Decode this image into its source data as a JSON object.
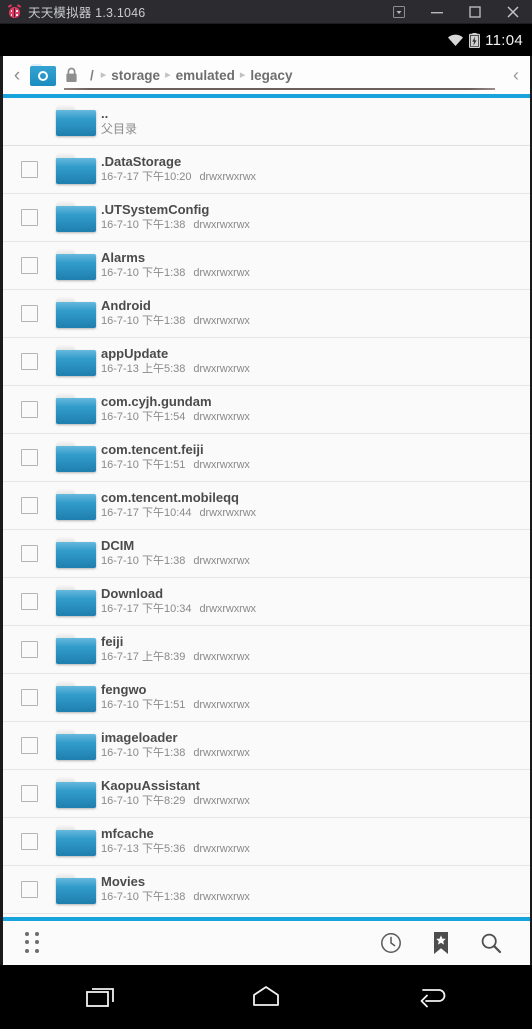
{
  "window": {
    "title": "天天模拟器 1.3.1046",
    "logo_icon": "ladybug-logo-icon",
    "controls": [
      {
        "name": "dropdown-box-button",
        "icon": "box-dropdown-icon",
        "label": ""
      },
      {
        "name": "minimize-button",
        "icon": "minimize-icon",
        "label": ""
      },
      {
        "name": "maximize-button",
        "icon": "maximize-icon",
        "label": ""
      },
      {
        "name": "close-button",
        "icon": "close-icon",
        "label": ""
      }
    ]
  },
  "statusbar": {
    "wifi_icon": "wifi-icon",
    "battery_icon": "battery-charging-icon",
    "clock": "11:04"
  },
  "addressbar": {
    "back_chevron": "‹",
    "folder_icon": "folder-root-icon",
    "lock_icon": "lock-icon",
    "root_label": "/",
    "separator": "▸",
    "crumbs": [
      "storage",
      "emulated",
      "legacy"
    ],
    "collapse_chevron": "‹"
  },
  "colors": {
    "accent": "#17a3dc",
    "folder_blue": "#2e97c6",
    "titlebar": "#2b2b30",
    "logo": "#e23b63"
  },
  "files": [
    {
      "name": "..",
      "sub": "父目录",
      "date": "",
      "perm": "",
      "checkbox": false,
      "parent": true
    },
    {
      "name": ".DataStorage",
      "sub": "",
      "date": "16-7-17 下午10:20",
      "perm": "drwxrwxrwx",
      "checkbox": true,
      "parent": false
    },
    {
      "name": ".UTSystemConfig",
      "sub": "",
      "date": "16-7-10 下午1:38",
      "perm": "drwxrwxrwx",
      "checkbox": true,
      "parent": false
    },
    {
      "name": "Alarms",
      "sub": "",
      "date": "16-7-10 下午1:38",
      "perm": "drwxrwxrwx",
      "checkbox": true,
      "parent": false
    },
    {
      "name": "Android",
      "sub": "",
      "date": "16-7-10 下午1:38",
      "perm": "drwxrwxrwx",
      "checkbox": true,
      "parent": false
    },
    {
      "name": "appUpdate",
      "sub": "",
      "date": "16-7-13 上午5:38",
      "perm": "drwxrwxrwx",
      "checkbox": true,
      "parent": false
    },
    {
      "name": "com.cyjh.gundam",
      "sub": "",
      "date": "16-7-10 下午1:54",
      "perm": "drwxrwxrwx",
      "checkbox": true,
      "parent": false
    },
    {
      "name": "com.tencent.feiji",
      "sub": "",
      "date": "16-7-10 下午1:51",
      "perm": "drwxrwxrwx",
      "checkbox": true,
      "parent": false
    },
    {
      "name": "com.tencent.mobileqq",
      "sub": "",
      "date": "16-7-17 下午10:44",
      "perm": "drwxrwxrwx",
      "checkbox": true,
      "parent": false
    },
    {
      "name": "DCIM",
      "sub": "",
      "date": "16-7-10 下午1:38",
      "perm": "drwxrwxrwx",
      "checkbox": true,
      "parent": false
    },
    {
      "name": "Download",
      "sub": "",
      "date": "16-7-17 下午10:34",
      "perm": "drwxrwxrwx",
      "checkbox": true,
      "parent": false
    },
    {
      "name": "feiji",
      "sub": "",
      "date": "16-7-17 上午8:39",
      "perm": "drwxrwxrwx",
      "checkbox": true,
      "parent": false
    },
    {
      "name": "fengwo",
      "sub": "",
      "date": "16-7-10 下午1:51",
      "perm": "drwxrwxrwx",
      "checkbox": true,
      "parent": false
    },
    {
      "name": "imageloader",
      "sub": "",
      "date": "16-7-10 下午1:38",
      "perm": "drwxrwxrwx",
      "checkbox": true,
      "parent": false
    },
    {
      "name": "KaopuAssistant",
      "sub": "",
      "date": "16-7-10 下午8:29",
      "perm": "drwxrwxrwx",
      "checkbox": true,
      "parent": false
    },
    {
      "name": "mfcache",
      "sub": "",
      "date": "16-7-13 下午5:36",
      "perm": "drwxrwxrwx",
      "checkbox": true,
      "parent": false
    },
    {
      "name": "Movies",
      "sub": "",
      "date": "16-7-10 下午1:38",
      "perm": "drwxrwxrwx",
      "checkbox": true,
      "parent": false
    }
  ],
  "bottombar": {
    "menu_icon": "grid-dots-icon",
    "actions": [
      {
        "name": "history-button",
        "icon": "clock-icon"
      },
      {
        "name": "bookmark-button",
        "icon": "bookmark-star-icon"
      },
      {
        "name": "search-button",
        "icon": "search-icon"
      }
    ]
  },
  "navbar": {
    "buttons": [
      {
        "name": "recents-button",
        "icon": "recents-icon"
      },
      {
        "name": "home-button",
        "icon": "home-icon"
      },
      {
        "name": "back-button",
        "icon": "back-icon"
      }
    ]
  }
}
